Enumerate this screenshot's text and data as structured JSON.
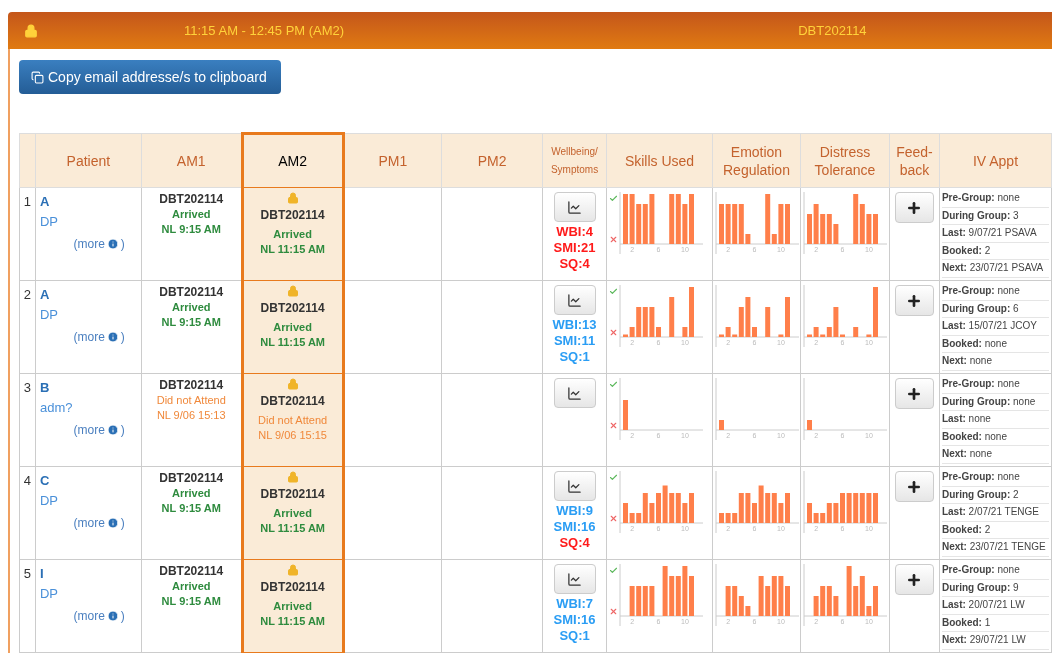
{
  "header": {
    "title": "11:15 AM - 12:45 PM (AM2)",
    "code": "DBT202114"
  },
  "copy_button": {
    "label": "Copy email addresse/s to clipboard"
  },
  "table": {
    "columns": [
      {
        "label": "Patient",
        "selected": false,
        "kind": "normal"
      },
      {
        "label": "AM1",
        "selected": false,
        "kind": "normal"
      },
      {
        "label": "AM2",
        "selected": true,
        "kind": "normal"
      },
      {
        "label": "PM1",
        "selected": false,
        "kind": "normal"
      },
      {
        "label": "PM2",
        "selected": false,
        "kind": "normal"
      },
      {
        "label": "Wellbeing/ Symptoms",
        "selected": false,
        "kind": "small"
      },
      {
        "label": "Skills Used",
        "selected": false,
        "kind": "normal"
      },
      {
        "label": "Emotion Regulation",
        "selected": false,
        "kind": "normal"
      },
      {
        "label": "Distress Tolerance",
        "selected": false,
        "kind": "normal"
      },
      {
        "label": "Feed-back",
        "selected": false,
        "kind": "normal"
      },
      {
        "label": "IV Appt",
        "selected": false,
        "kind": "normal"
      }
    ],
    "rows": [
      {
        "number": "1",
        "name": "A",
        "tag": "DP",
        "more": "(more",
        "more_end": ")",
        "sessions": [
          {
            "code": "DBT202114",
            "status": "Arrived",
            "note": "NL 9:15 AM",
            "kind": "arrived",
            "locked": false
          },
          {
            "code": "DBT202114",
            "status": "Arrived",
            "note": "NL 11:15 AM",
            "kind": "arrived",
            "locked": true
          }
        ],
        "metrics": [
          {
            "text": "WBI:4",
            "alert": true
          },
          {
            "text": "SMI:21",
            "alert": true
          },
          {
            "text": "SQ:4",
            "alert": true
          }
        ],
        "charts": [
          {
            "ticks": [
              "2",
              "6",
              "10"
            ]
          },
          {
            "ticks": [
              "2",
              "6",
              "10"
            ]
          },
          {
            "ticks": [
              "2",
              "6",
              "10"
            ]
          }
        ],
        "appt": [
          "**Pre-Group:** none",
          "**During Group:** 3",
          "**Last:** 9/07/21 PSAVA",
          "**Booked:** 2",
          "**Next:** 23/07/21 PSAVA"
        ]
      },
      {
        "number": "2",
        "name": "A",
        "tag": "DP",
        "more": "(more",
        "more_end": ")",
        "sessions": [
          {
            "code": "DBT202114",
            "status": "Arrived",
            "note": "NL 9:15 AM",
            "kind": "arrived",
            "locked": false
          },
          {
            "code": "DBT202114",
            "status": "Arrived",
            "note": "NL 11:15 AM",
            "kind": "arrived",
            "locked": true
          }
        ],
        "metrics": [
          {
            "text": "WBI:13",
            "alert": false
          },
          {
            "text": "SMI:11",
            "alert": false
          },
          {
            "text": "SQ:1",
            "alert": false
          }
        ],
        "charts": [
          {
            "ticks": [
              "2",
              "6",
              "10"
            ]
          },
          {
            "ticks": [
              "2",
              "6",
              "10"
            ]
          },
          {
            "ticks": [
              "2",
              "6",
              "10"
            ]
          }
        ],
        "appt": [
          "**Pre-Group:** none",
          "**During Group:** 6",
          "**Last:** 15/07/21 JCOY",
          "**Booked:** none",
          "**Next:** none"
        ]
      },
      {
        "number": "3",
        "name": "B",
        "tag": "adm?",
        "more": "(more",
        "more_end": ")",
        "sessions": [
          {
            "code": "DBT202114",
            "status": "Did not Attend",
            "note": "NL 9/06 15:13",
            "kind": "dna",
            "locked": false
          },
          {
            "code": "DBT202114",
            "status": "Did not Attend",
            "note": "NL 9/06 15:15",
            "kind": "dna",
            "locked": true
          }
        ],
        "metrics": [],
        "charts": [
          {
            "ticks": [
              "2",
              "6",
              "10"
            ]
          },
          {
            "ticks": [
              "2",
              "6",
              "10"
            ]
          },
          {
            "ticks": [
              "2",
              "6",
              "10"
            ]
          }
        ],
        "appt": [
          "**Pre-Group:** none",
          "**During Group:** none",
          "**Last:** none",
          "**Booked:** none",
          "**Next:** none"
        ]
      },
      {
        "number": "4",
        "name": "C",
        "tag": "DP",
        "more": "(more",
        "more_end": ")",
        "sessions": [
          {
            "code": "DBT202114",
            "status": "Arrived",
            "note": "NL 9:15 AM",
            "kind": "arrived",
            "locked": false
          },
          {
            "code": "DBT202114",
            "status": "Arrived",
            "note": "NL 11:15 AM",
            "kind": "arrived",
            "locked": true
          }
        ],
        "metrics": [
          {
            "text": "WBI:9",
            "alert": false
          },
          {
            "text": "SMI:16",
            "alert": false
          },
          {
            "text": "SQ:4",
            "alert": true
          }
        ],
        "charts": [
          {
            "ticks": [
              "2",
              "6",
              "10"
            ]
          },
          {
            "ticks": [
              "2",
              "6",
              "10"
            ]
          },
          {
            "ticks": [
              "2",
              "6",
              "10"
            ]
          }
        ],
        "appt": [
          "**Pre-Group:** none",
          "**During Group:** 2",
          "**Last:** 2/07/21 TENGE",
          "**Booked:** 2",
          "**Next:** 23/07/21 TENGE"
        ]
      },
      {
        "number": "5",
        "name": "I",
        "tag": "DP",
        "more": "(more",
        "more_end": ")",
        "sessions": [
          {
            "code": "DBT202114",
            "status": "Arrived",
            "note": "NL 9:15 AM",
            "kind": "arrived",
            "locked": false
          },
          {
            "code": "DBT202114",
            "status": "Arrived",
            "note": "NL 11:15 AM",
            "kind": "arrived",
            "locked": true
          }
        ],
        "metrics": [
          {
            "text": "WBI:7",
            "alert": false
          },
          {
            "text": "SMI:16",
            "alert": false
          },
          {
            "text": "SQ:1",
            "alert": false
          }
        ],
        "charts": [
          {
            "ticks": [
              "2",
              "6",
              "10"
            ]
          },
          {
            "ticks": [
              "2",
              "6",
              "10"
            ]
          },
          {
            "ticks": [
              "2",
              "6",
              "10"
            ]
          }
        ],
        "appt": [
          "**Pre-Group:** none",
          "**During Group:** 9",
          "**Last:** 20/07/21 LW",
          "**Booked:** 1",
          "**Next:** 29/07/21 LW"
        ]
      }
    ]
  }
}
